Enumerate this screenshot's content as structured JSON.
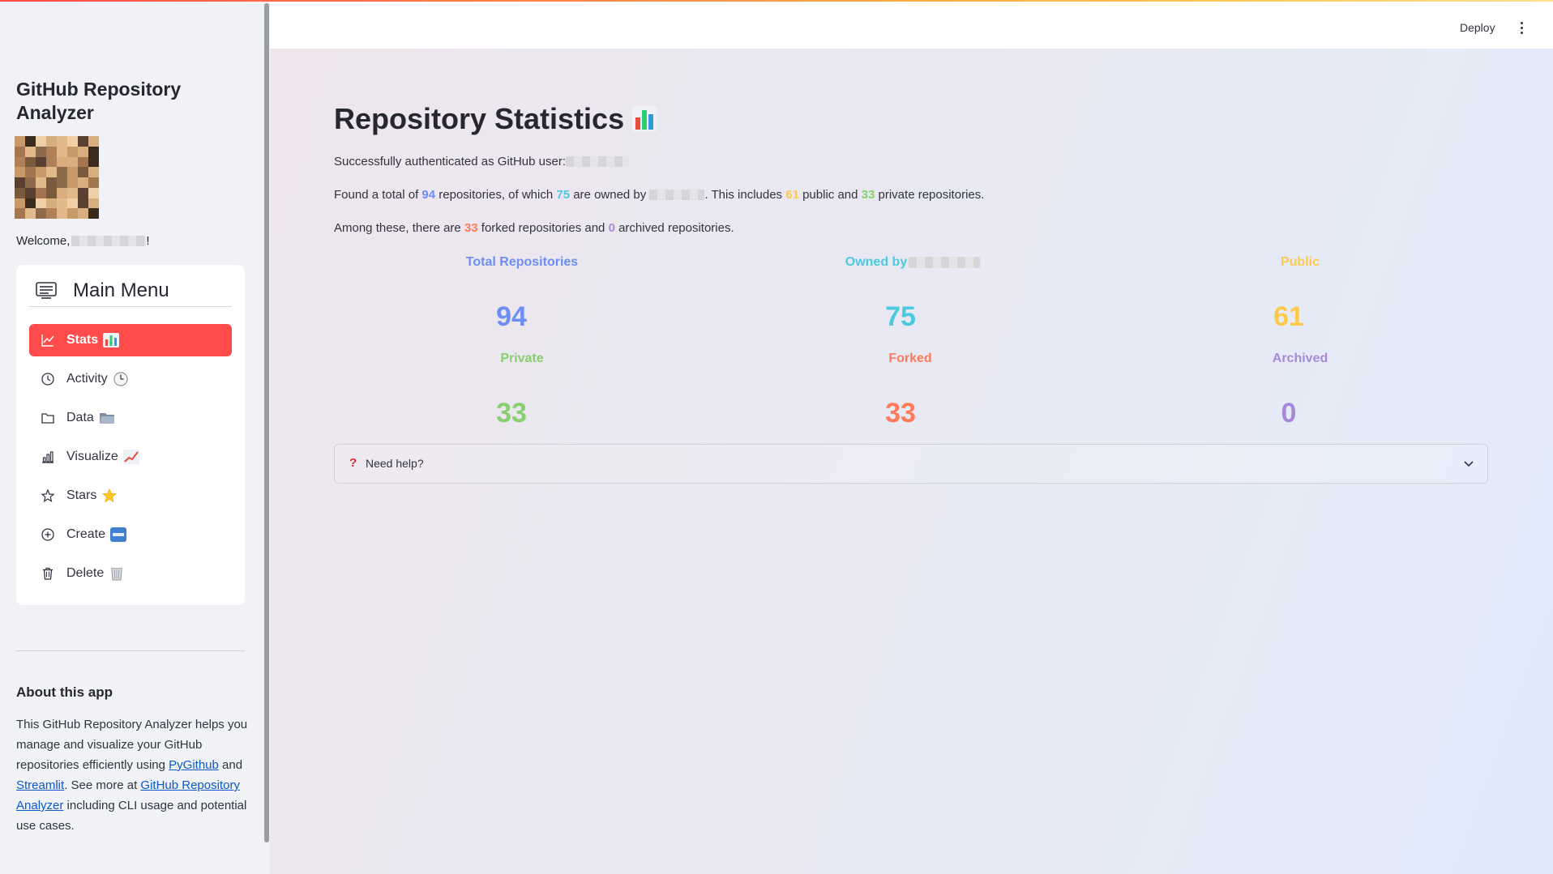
{
  "sidebar": {
    "app_title": "GitHub Repository Analyzer",
    "welcome_prefix": "Welcome,",
    "welcome_suffix": "!",
    "menu_title": "Main Menu",
    "items": [
      {
        "label": "Stats",
        "icon": "line-chart-icon",
        "emoji": "bar-chart-emoji",
        "active": true
      },
      {
        "label": "Activity",
        "icon": "clock-icon",
        "emoji": "clock-emoji",
        "active": false
      },
      {
        "label": "Data",
        "icon": "folder-icon",
        "emoji": "folder-emoji",
        "active": false
      },
      {
        "label": "Visualize",
        "icon": "bar-chart-icon",
        "emoji": "chart-increasing-emoji",
        "active": false
      },
      {
        "label": "Stars",
        "icon": "star-icon",
        "emoji": "star-emoji",
        "active": false
      },
      {
        "label": "Create",
        "icon": "plus-circle-icon",
        "emoji": "new-button-emoji",
        "active": false
      },
      {
        "label": "Delete",
        "icon": "trash-icon",
        "emoji": "wastebasket-emoji",
        "active": false
      }
    ],
    "about": {
      "title": "About this app",
      "text1": "This GitHub Repository Analyzer helps you manage and visualize your GitHub repositories efficiently using ",
      "link1": "PyGithub",
      "text2": " and ",
      "link2": "Streamlit",
      "text3": ". See more at ",
      "link3": "GitHub Repository Analyzer",
      "text4": " including CLI usage and potential use cases."
    }
  },
  "header": {
    "deploy_label": "Deploy"
  },
  "main": {
    "title": "Repository Statistics",
    "auth_text": "Successfully authenticated as GitHub user:",
    "found": {
      "p1": "Found a total of ",
      "total": "94",
      "p2": " repositories, of which ",
      "owned": "75",
      "p3": " are owned by ",
      "p4": ". This includes ",
      "public": "61",
      "p5": " public and ",
      "private": "33",
      "p6": " private repositories."
    },
    "among": {
      "p1": "Among these, there are ",
      "forked": "33",
      "p2": " forked repositories and ",
      "archived": "0",
      "p3": " archived repositories."
    },
    "metrics": [
      {
        "label": "Total Repositories",
        "value": "94",
        "color": "#6c8ef5"
      },
      {
        "label": "Owned by",
        "value": "75",
        "color": "#4cc9e0"
      },
      {
        "label": "Public",
        "value": "61",
        "color": "#ffc94d"
      },
      {
        "label": "Private",
        "value": "33",
        "color": "#88cf6f"
      },
      {
        "label": "Forked",
        "value": "33",
        "color": "#ff7a59"
      },
      {
        "label": "Archived",
        "value": "0",
        "color": "#a889d8"
      }
    ],
    "help_label": "Need help?"
  },
  "colors": {
    "accent": "#ff4b4b",
    "link": "#0a58ca"
  }
}
